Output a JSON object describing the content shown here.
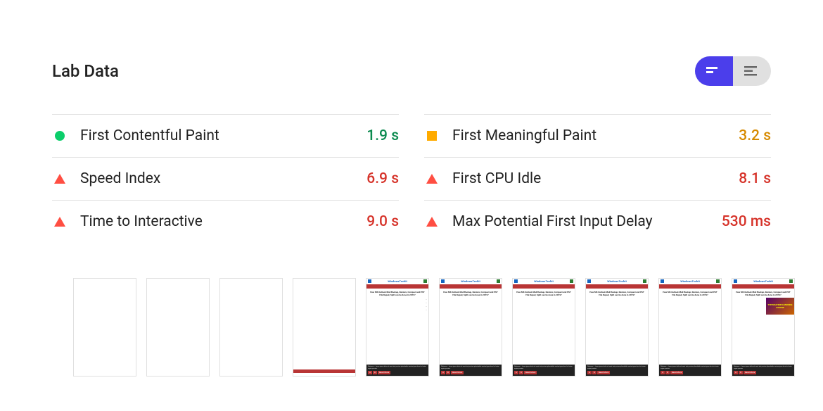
{
  "title": "Lab Data",
  "colors": {
    "pass": "#0CCE6B",
    "warn": "#FFAB00",
    "fail": "#FF4E42",
    "accent": "#4B3EEB"
  },
  "view_toggle": {
    "active": "detail",
    "options": [
      "detail",
      "compact"
    ]
  },
  "metrics_left": [
    {
      "label": "First Contentful Paint",
      "value": "1.9 s",
      "status": "pass"
    },
    {
      "label": "Speed Index",
      "value": "6.9 s",
      "status": "fail"
    },
    {
      "label": "Time to Interactive",
      "value": "9.0 s",
      "status": "fail"
    }
  ],
  "metrics_right": [
    {
      "label": "First Meaningful Paint",
      "value": "3.2 s",
      "status": "warn"
    },
    {
      "label": "First CPU Idle",
      "value": "8.1 s",
      "status": "fail"
    },
    {
      "label": "Max Potential First Input Delay",
      "value": "530 ms",
      "status": "fail"
    }
  ],
  "filmstrip": {
    "site_name": "WindowsTechIt",
    "article_title": "How MS Outlook Mail Backup, Restore, Compact and PST File Repair, Split can be done in 2019?",
    "frames": [
      {
        "state": "blank"
      },
      {
        "state": "blank"
      },
      {
        "state": "blank"
      },
      {
        "state": "loading"
      },
      {
        "state": "partial"
      },
      {
        "state": "content"
      },
      {
        "state": "content"
      },
      {
        "state": "content"
      },
      {
        "state": "content"
      },
      {
        "state": "full"
      }
    ]
  }
}
